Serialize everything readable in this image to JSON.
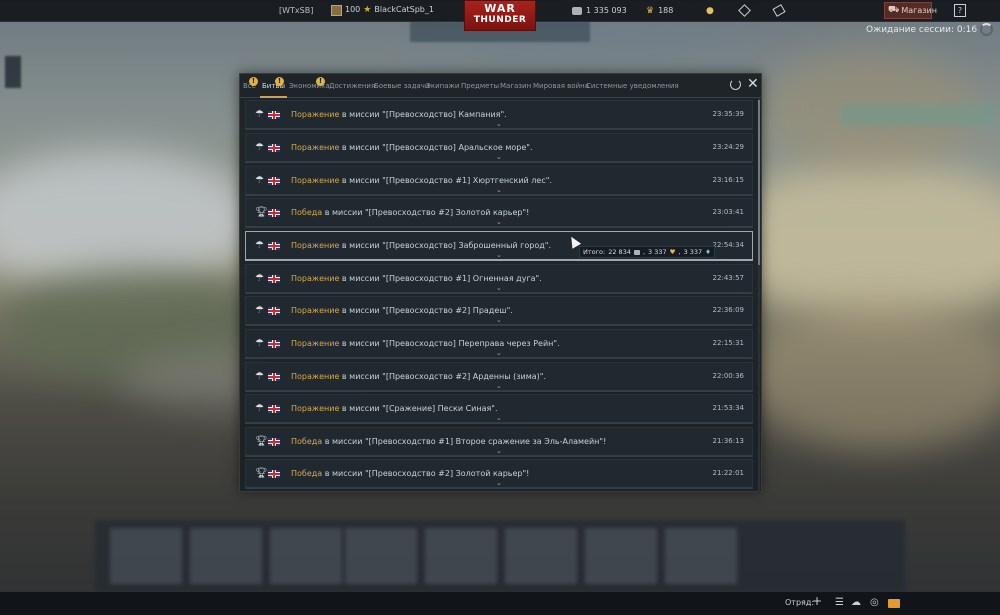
{
  "topbar": {
    "clan_tag": "[WTxSB]",
    "rank": "100",
    "nickname": "BlackCatSpb_1",
    "logo_line1": "WAR",
    "logo_line2": "THUNDER",
    "silver_lions": "1 335 093",
    "golden_eagles": "188",
    "shop_label": "Магазин",
    "help_label": "?",
    "session_wait": "Ожидание сессии: 0:16"
  },
  "panel": {
    "tabs": [
      {
        "label": "Все",
        "alert": true
      },
      {
        "label": "Битвы",
        "alert": true,
        "active": true
      },
      {
        "label": "Экономика",
        "alert": true
      },
      {
        "label": "Достижения"
      },
      {
        "label": "Боевые задачи"
      },
      {
        "label": "Экипажи"
      },
      {
        "label": "Предметы"
      },
      {
        "label": "Магазин"
      },
      {
        "label": "Мировая война"
      },
      {
        "label": "Системные уведомления"
      }
    ],
    "alert_symbol": "!",
    "rows": [
      {
        "result": "Поражение",
        "text": " в миссии \"[Превосходство] Кампания\".",
        "time": "23:35:39",
        "icon": "parachute-icon"
      },
      {
        "result": "Поражение",
        "text": " в миссии \"[Превосходство] Аральское море\".",
        "time": "23:24:29",
        "icon": "parachute-icon"
      },
      {
        "result": "Поражение",
        "text": " в миссии \"[Превосходство #1] Хюртгенский лес\".",
        "time": "23:16:15",
        "icon": "parachute-icon"
      },
      {
        "result": "Победа",
        "text": " в миссии \"[Превосходство #2] Золотой карьер\"!",
        "time": "23:03:41",
        "icon": "trophy-icon"
      },
      {
        "result": "Поражение",
        "text": " в миссии \"[Превосходство] Заброшенный город\".",
        "time": "22:54:34",
        "icon": "parachute-icon",
        "highlighted": true
      },
      {
        "result": "Поражение",
        "text": " в миссии \"[Превосходство #1] Огненная дуга\".",
        "time": "22:43:57",
        "icon": "parachute-icon"
      },
      {
        "result": "Поражение",
        "text": " в миссии \"[Превосходство #2] Прадеш\".",
        "time": "22:36:09",
        "icon": "parachute-icon"
      },
      {
        "result": "Поражение",
        "text": " в миссии \"[Превосходство] Переправа через Рейн\".",
        "time": "22:15:31",
        "icon": "parachute-icon"
      },
      {
        "result": "Поражение",
        "text": " в миссии \"[Превосходство #2] Арденны (зима)\".",
        "time": "22:00:36",
        "icon": "parachute-icon"
      },
      {
        "result": "Поражение",
        "text": " в миссии \"[Сражение] Пески Синая\".",
        "time": "21:53:34",
        "icon": "parachute-icon"
      },
      {
        "result": "Победа",
        "text": " в миссии \"[Превосходство #1] Второе сражение за Эль-Аламейн\"!",
        "time": "21:36:13",
        "icon": "trophy-icon"
      },
      {
        "result": "Победа",
        "text": " в миссии \"[Превосходство #2] Золотой карьер\"!",
        "time": "21:22:01",
        "icon": "trophy-icon"
      }
    ],
    "tooltip": {
      "label": "Итого:",
      "silver": "22 834",
      "crew": "3 337",
      "research": "3 337"
    }
  },
  "bottombar": {
    "squad_label": "Отряд:"
  },
  "colors": {
    "result_accent": "#d9a94a",
    "logo_red": "#a8231c"
  }
}
